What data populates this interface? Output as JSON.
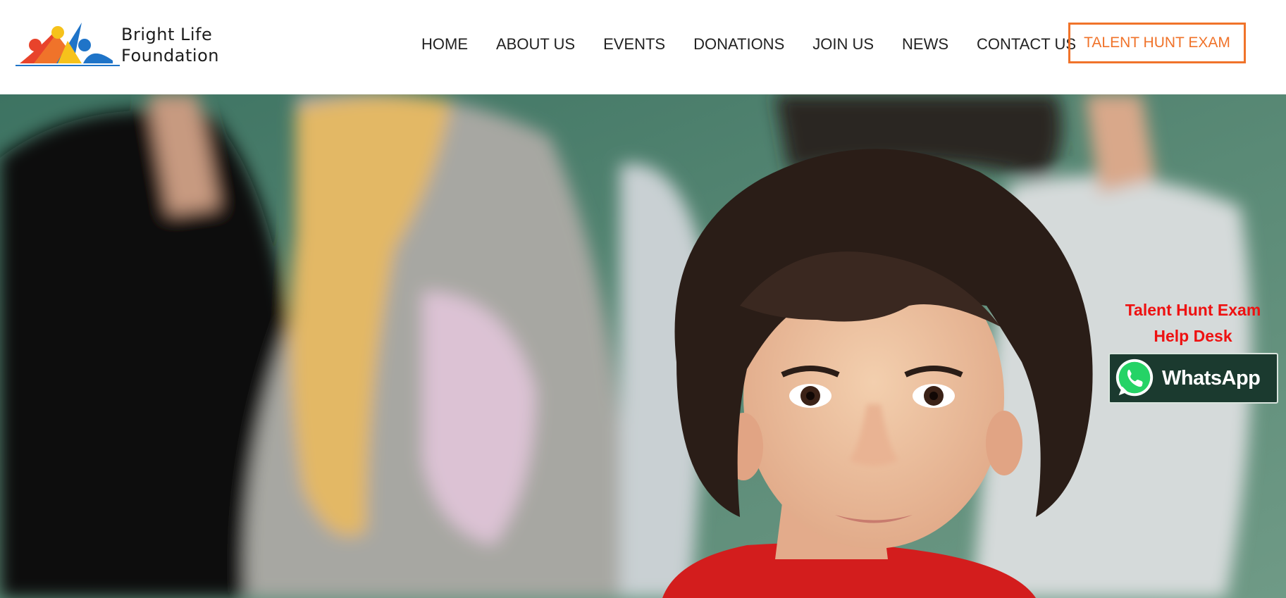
{
  "brand": {
    "name_line1": "Bright Life",
    "name_line2": "Foundation",
    "colors": {
      "orange": "#f0732a",
      "red": "#e8432b",
      "yellow": "#f6c21b",
      "blue": "#1f74c8"
    }
  },
  "nav": {
    "items": [
      {
        "label": "HOME"
      },
      {
        "label": "ABOUT US"
      },
      {
        "label": "EVENTS"
      },
      {
        "label": "DONATIONS"
      },
      {
        "label": "JOIN US"
      },
      {
        "label": "NEWS"
      },
      {
        "label": "CONTACT US"
      }
    ],
    "cta_label": "TALENT HUNT EXAM"
  },
  "hero": {
    "image": "children-classroom-photo"
  },
  "helpdesk": {
    "line1": "Talent Hunt Exam",
    "line2": "Help Desk",
    "whatsapp_label": "WhatsApp",
    "icon": "whatsapp-icon"
  }
}
